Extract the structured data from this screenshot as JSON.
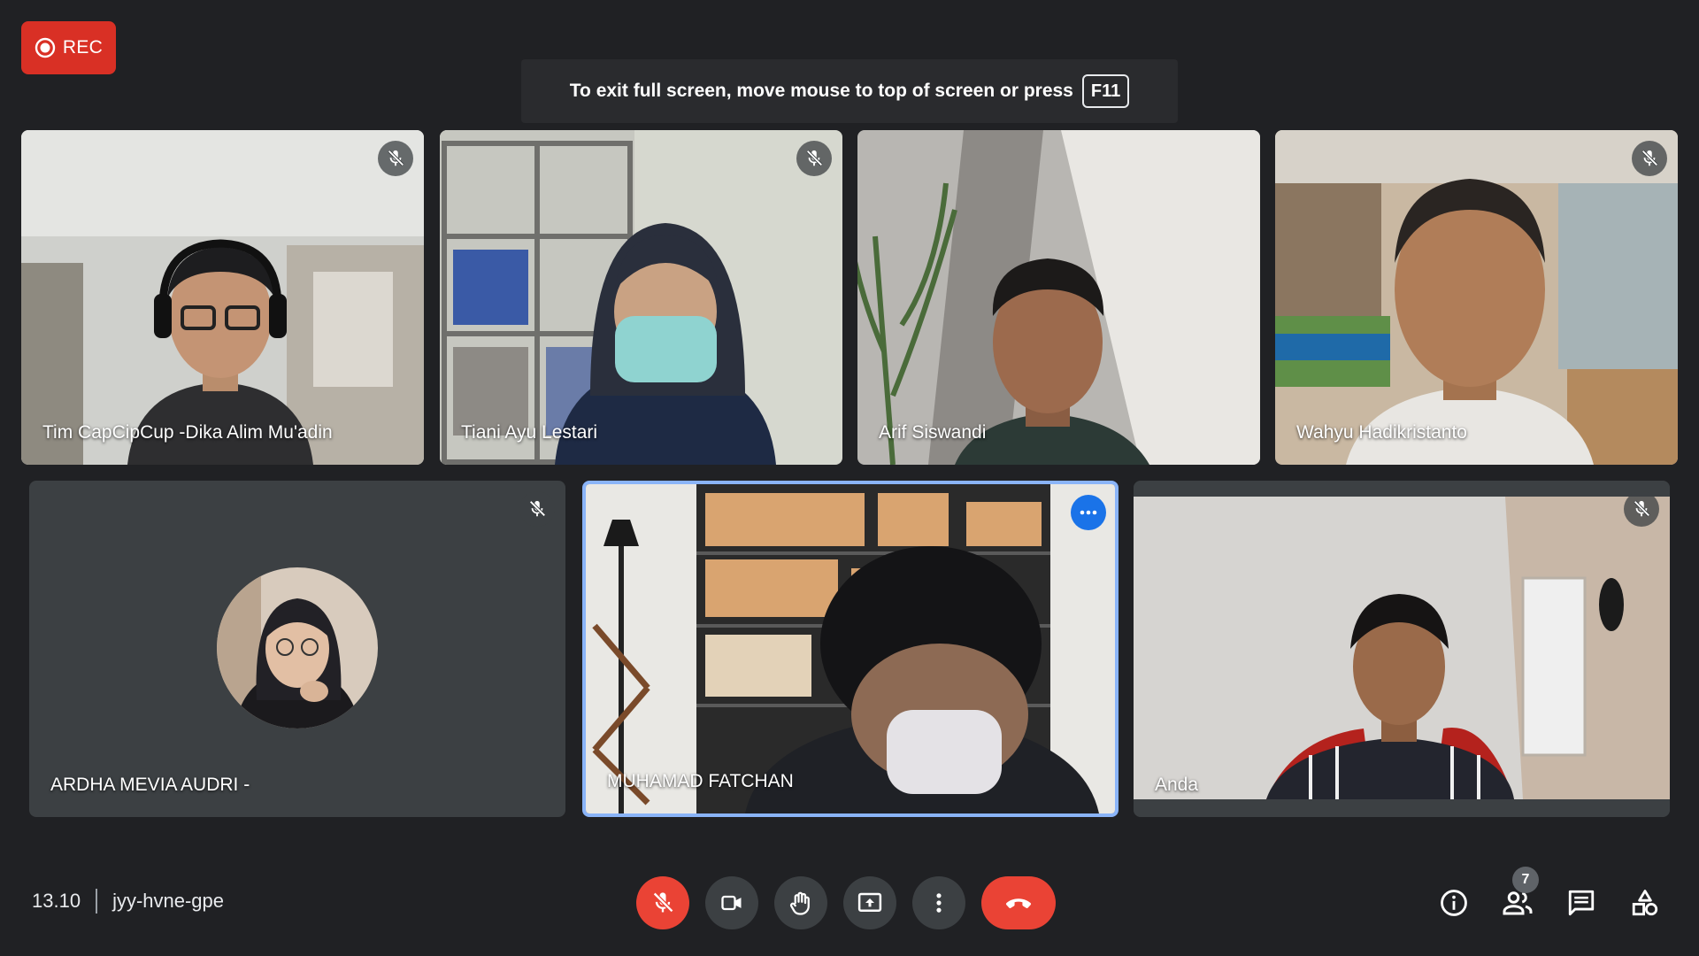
{
  "recording": {
    "label": "REC"
  },
  "fullscreen_banner": {
    "message": "To exit full screen, move mouse to top of screen or press",
    "key": "F11"
  },
  "participants": [
    {
      "name": "Tim CapCipCup -Dika Alim Mu'adin",
      "muted": true
    },
    {
      "name": "Tiani Ayu Lestari",
      "muted": true
    },
    {
      "name": "Arif Siswandi",
      "muted": false
    },
    {
      "name": "Wahyu Hadikristanto",
      "muted": true
    },
    {
      "name": "ARDHA MEVIA AUDRI -",
      "muted": true,
      "camera_off": true
    },
    {
      "name": "MUHAMAD FATCHAN",
      "muted": false,
      "speaking": true
    },
    {
      "name": "Anda",
      "muted": true
    }
  ],
  "meeting": {
    "time": "13.10",
    "code": "jyy-hvne-gpe"
  },
  "controls": [
    {
      "icon": "mic-off-icon",
      "state": "off"
    },
    {
      "icon": "camera-icon"
    },
    {
      "icon": "raise-hand-icon"
    },
    {
      "icon": "present-screen-icon"
    },
    {
      "icon": "more-options-icon"
    },
    {
      "icon": "end-call-icon"
    }
  ],
  "right_controls": {
    "people_count": "7",
    "icons": [
      "info-icon",
      "people-icon",
      "chat-icon",
      "activities-icon"
    ]
  },
  "colors": {
    "accent": "#1a73e8",
    "danger": "#ea4335",
    "rec": "#d93025",
    "background": "#202124",
    "tile": "#3c4043",
    "speaking_border": "#8ab4f8"
  }
}
